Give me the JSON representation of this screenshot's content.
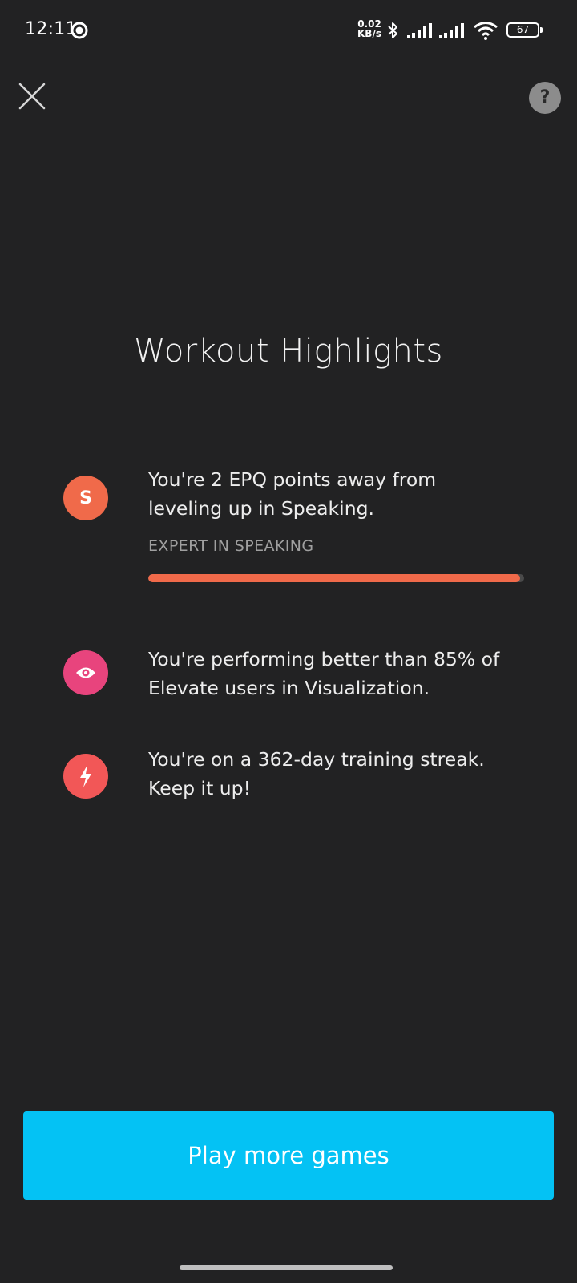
{
  "status_bar": {
    "time": "12:11",
    "net_speed_value": "0.02",
    "net_speed_unit": "KB/s",
    "battery": "67",
    "icons": [
      "record-icon",
      "bluetooth-icon",
      "signal-icon",
      "signal-icon",
      "wifi-icon",
      "battery-icon"
    ]
  },
  "header": {
    "close_icon": "close-icon",
    "help_label": "?"
  },
  "title": "Workout Highlights",
  "highlights": [
    {
      "icon": "speaking-badge-icon",
      "badge_letter": "S",
      "color": "#f06a4a",
      "line1": "You're 2 EPQ points away from",
      "line2": "leveling up in Speaking.",
      "skill_label": "EXPERT IN SPEAKING",
      "progress": 0.99
    },
    {
      "icon": "eye-icon",
      "color": "#e8447d",
      "line1": "You're performing better than 85% of",
      "line2": "Elevate users in Visualization."
    },
    {
      "icon": "lightning-icon",
      "color": "#f25757",
      "line1": "You're on a 362-day training streak.",
      "line2": "Keep it up!"
    }
  ],
  "cta": {
    "label": "Play more games",
    "color": "#04c2f4"
  }
}
